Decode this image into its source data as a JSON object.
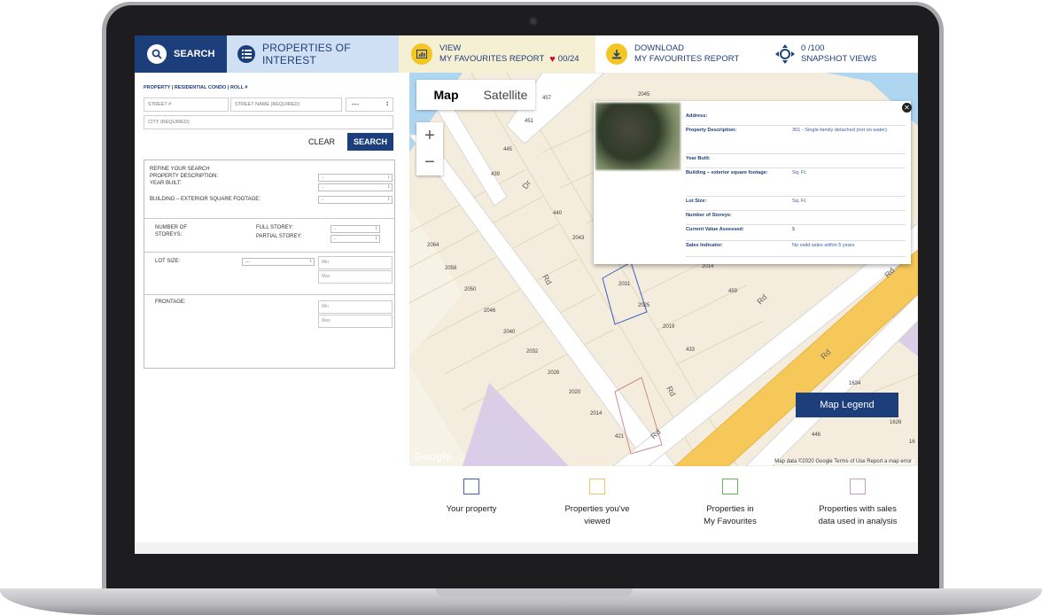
{
  "nav": {
    "search_label": "SEARCH",
    "properties_label": "PROPERTIES OF INTEREST",
    "view_line1": "VIEW",
    "view_line2": "MY FAVOURITES REPORT",
    "fav_count": "00/24",
    "download_line1": "DOWNLOAD",
    "download_line2": "MY FAVOURITES REPORT",
    "snapshot_line1": "0 /100",
    "snapshot_line2": "SNAPSHOT VIEWS"
  },
  "search": {
    "crumb_property": "PROPERTY",
    "crumb_condo": "RESIDENTIAL CONDO",
    "crumb_roll": "ROLL #",
    "street_no": "STREET #",
    "street_name": "STREET NAME (REQUIRED)",
    "street_type": "---",
    "city": "CITY (REQUIRED)",
    "clear_label": "CLEAR",
    "search_label": "SEARCH"
  },
  "refine": {
    "title": "REFINE YOUR SEARCH",
    "property_description": "PROPERTY DESCRIPTION:",
    "year_built": "YEAR BUILT:",
    "building_footage": "BUILDING – EXTERIOR SQUARE FOOTAGE:",
    "number_of_storeys": "NUMBER OF STOREYS:",
    "full_storey": "FULL STOREY:",
    "partial_storey": "PARTIAL STOREY:",
    "lot_size": "LOT SIZE:",
    "lot_select": "---",
    "frontage": "FRONTAGE:",
    "select_default": "-",
    "min": "Min",
    "max": "Max"
  },
  "map": {
    "map_btn": "Map",
    "satellite_btn": "Satellite",
    "zoom_in": "+",
    "zoom_out": "−",
    "legend_button": "Map Legend",
    "attribution": "Map data ©2020 Google   Terms of Use   Report a map error",
    "google": "Google",
    "lot_numbers": [
      "457",
      "2045",
      "451",
      "445",
      "439",
      "440",
      "2043",
      "2064",
      "2058",
      "2050",
      "2046",
      "2040",
      "2032",
      "2026",
      "2020",
      "2014",
      "421",
      "2031",
      "2025",
      "2019",
      "433",
      "2014",
      "459",
      "1634",
      "446",
      "1626",
      "16"
    ],
    "road_labels": [
      "Dr",
      "Rd",
      "Rd",
      "Rd",
      "Rd",
      "Rd",
      "Rd"
    ]
  },
  "popup": {
    "rows": [
      {
        "key": "Address:",
        "value": ""
      },
      {
        "key": "Property Description:",
        "value": "301 - Single-family detached (not on water)"
      },
      {
        "key": "Year Built:",
        "value": ""
      },
      {
        "key": "Building – exterior square footage:",
        "value": "Sq. Ft."
      },
      {
        "key": "Lot Size:",
        "value": "Sq. Ft."
      },
      {
        "key": "Number of Storeys:",
        "value": ""
      },
      {
        "key": "Current Value Assessed:",
        "value": "$"
      },
      {
        "key": "Sales Indicator:",
        "value": "No valid sales within 5 years"
      }
    ]
  },
  "legend": {
    "items": [
      {
        "label": "Your property",
        "color": "#3b5fc4"
      },
      {
        "label": "Properties you've viewed",
        "color": "#f2c36b"
      },
      {
        "label": "Properties in My Favourites",
        "color": "#66b35a"
      },
      {
        "label": "Properties with sales data used in analysis",
        "color": "#c79ac9"
      }
    ]
  },
  "colors": {
    "brand_navy": "#1c3f7c",
    "heart": "#c8102e",
    "highway": "#f6c85a"
  }
}
